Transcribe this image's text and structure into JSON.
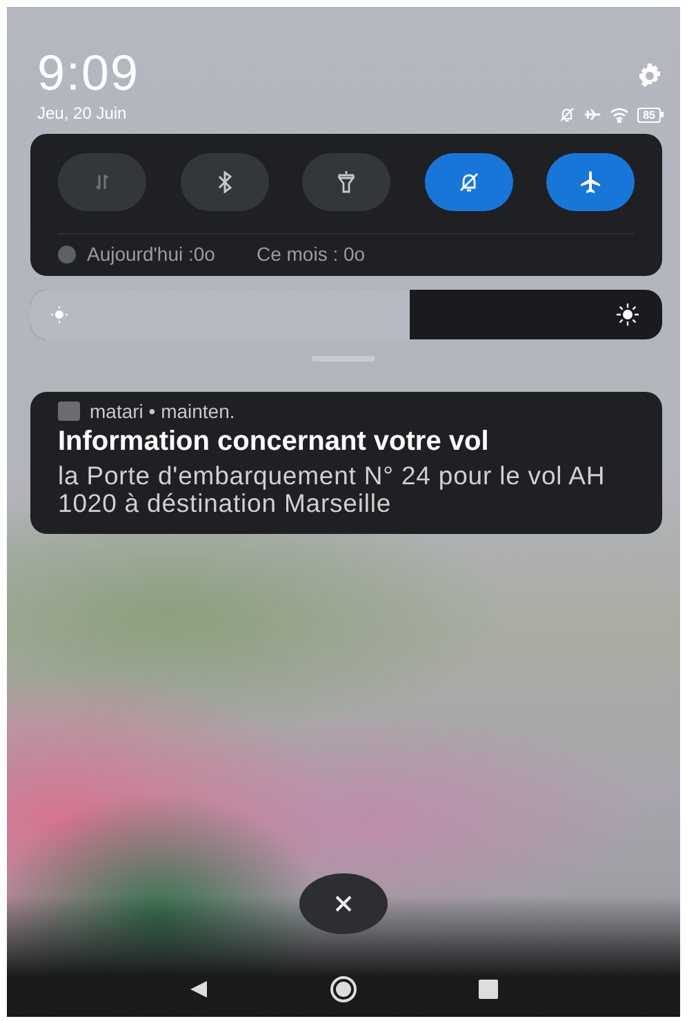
{
  "clock": {
    "time": "9:09",
    "date": "Jeu, 20 Juin"
  },
  "status_bar": {
    "battery": "85"
  },
  "quick_toggles": [
    {
      "kind": "data",
      "on": false
    },
    {
      "kind": "bluetooth",
      "on": false
    },
    {
      "kind": "flashlight",
      "on": false
    },
    {
      "kind": "mute",
      "on": true
    },
    {
      "kind": "airplane",
      "on": true
    }
  ],
  "data_usage": {
    "today": "Aujourd'hui :0o",
    "month": "Ce mois : 0o"
  },
  "brightness": {
    "level": 0.6
  },
  "notification": {
    "app": "matari • mainten.",
    "title": "Information concernant votre vol",
    "body": "la Porte d'embarquement N° 24 pour le vol AH 1020 à déstination Marseille"
  }
}
